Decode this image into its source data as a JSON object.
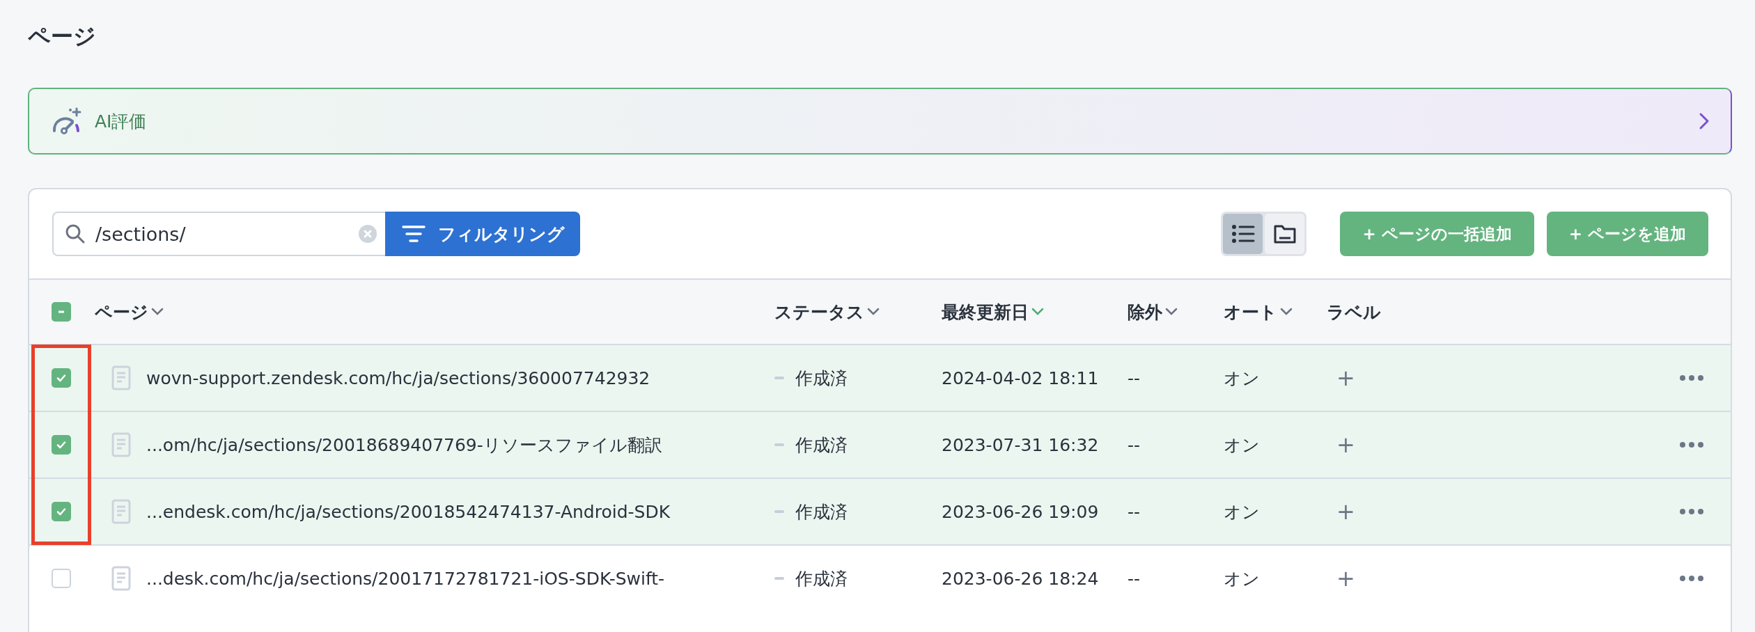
{
  "page_title": "ページ",
  "ai_banner": {
    "label": "AI評価"
  },
  "toolbar": {
    "search": {
      "value": "/sections/"
    },
    "filter_button": "フィルタリング",
    "view_toggle": [
      {
        "kind": "list",
        "selected": true
      },
      {
        "kind": "folder",
        "selected": false
      }
    ],
    "buttons": [
      "+ ページの一括追加",
      "+ ページを追加"
    ]
  },
  "table": {
    "header_checkbox": {
      "indeterminate": true
    },
    "columns": [
      {
        "label": "ページ",
        "sortable": true,
        "sorted": false
      },
      {
        "label": "ステータス",
        "sortable": true,
        "sorted": false
      },
      {
        "label": "最終更新日",
        "sortable": true,
        "sorted": true
      },
      {
        "label": "除外",
        "sortable": true,
        "sorted": false
      },
      {
        "label": "オート",
        "sortable": true,
        "sorted": false
      },
      {
        "label": "ラベル",
        "sortable": false
      }
    ],
    "rows": [
      {
        "selected": true,
        "page": "wovn-support.zendesk.com/hc/ja/sections/360007742932",
        "status": "作成済",
        "updated": "2024-04-02 18:11",
        "excluded": "--",
        "auto": "オン",
        "label_add": "+"
      },
      {
        "selected": true,
        "page": "...om/hc/ja/sections/20018689407769-リソースファイル翻訳",
        "status": "作成済",
        "updated": "2023-07-31 16:32",
        "excluded": "--",
        "auto": "オン",
        "label_add": "+"
      },
      {
        "selected": true,
        "page": "...endesk.com/hc/ja/sections/20018542474137-Android-SDK",
        "status": "作成済",
        "updated": "2023-06-26 19:09",
        "excluded": "--",
        "auto": "オン",
        "label_add": "+"
      },
      {
        "selected": false,
        "page": "...desk.com/hc/ja/sections/20017172781721-iOS-SDK-Swift-",
        "status": "作成済",
        "updated": "2023-06-26 18:24",
        "excluded": "--",
        "auto": "オン",
        "label_add": "+"
      }
    ]
  }
}
